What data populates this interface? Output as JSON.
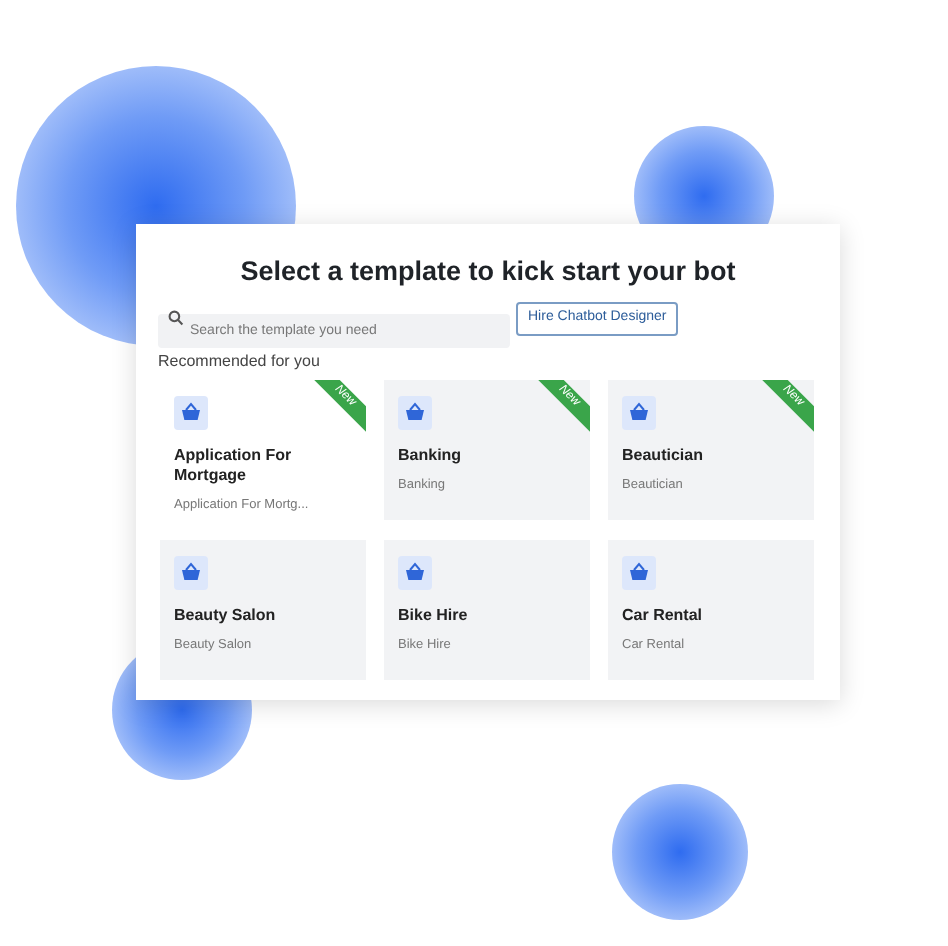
{
  "title": "Select a template to kick start your bot",
  "search": {
    "placeholder": "Search the template you need"
  },
  "hire_button": "Hire Chatbot Designer",
  "section_label": "Recommended for you",
  "templates": [
    {
      "name": "Application For Mortgage",
      "subtitle": "Application For Mortg...",
      "ribbon": "New",
      "selected": true
    },
    {
      "name": "Banking",
      "subtitle": "Banking",
      "ribbon": "New",
      "selected": false
    },
    {
      "name": "Beautician",
      "subtitle": "Beautician",
      "ribbon": "New",
      "selected": false
    },
    {
      "name": "Beauty Salon",
      "subtitle": "Beauty Salon",
      "selected": false
    },
    {
      "name": "Bike Hire",
      "subtitle": "Bike Hire",
      "selected": false
    },
    {
      "name": "Car Rental",
      "subtitle": "Car Rental",
      "selected": false
    }
  ]
}
